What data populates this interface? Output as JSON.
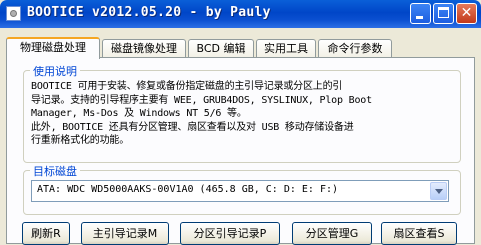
{
  "window": {
    "title": "BOOTICE v2012.05.20 - by Pauly"
  },
  "tabs": [
    {
      "label": "物理磁盘处理"
    },
    {
      "label": "磁盘镜像处理"
    },
    {
      "label": "BCD 编辑"
    },
    {
      "label": "实用工具"
    },
    {
      "label": "命令行参数"
    }
  ],
  "description": {
    "legend": "使用说明",
    "lines": [
      "BOOTICE 可用于安装、修复或备份指定磁盘的主引导记录或分区上的引",
      "导记录。支持的引导程序主要有 WEE, GRUB4DOS, SYSLINUX, Plop Boot",
      "Manager, Ms-Dos 及 Windows NT 5/6 等。",
      "此外, BOOTICE 还具有分区管理、扇区查看以及对 USB 移动存储设备进",
      "行重新格式化的功能。"
    ]
  },
  "target": {
    "legend": "目标磁盘",
    "selected": "ATA: WDC WD5000AAKS-00V1A0 (465.8 GB, C: D: E: F:)"
  },
  "buttons": [
    {
      "label": "刷新R"
    },
    {
      "label": "主引导记录M"
    },
    {
      "label": "分区引导记录P"
    },
    {
      "label": "分区管理G"
    },
    {
      "label": "扇区查看S"
    }
  ]
}
